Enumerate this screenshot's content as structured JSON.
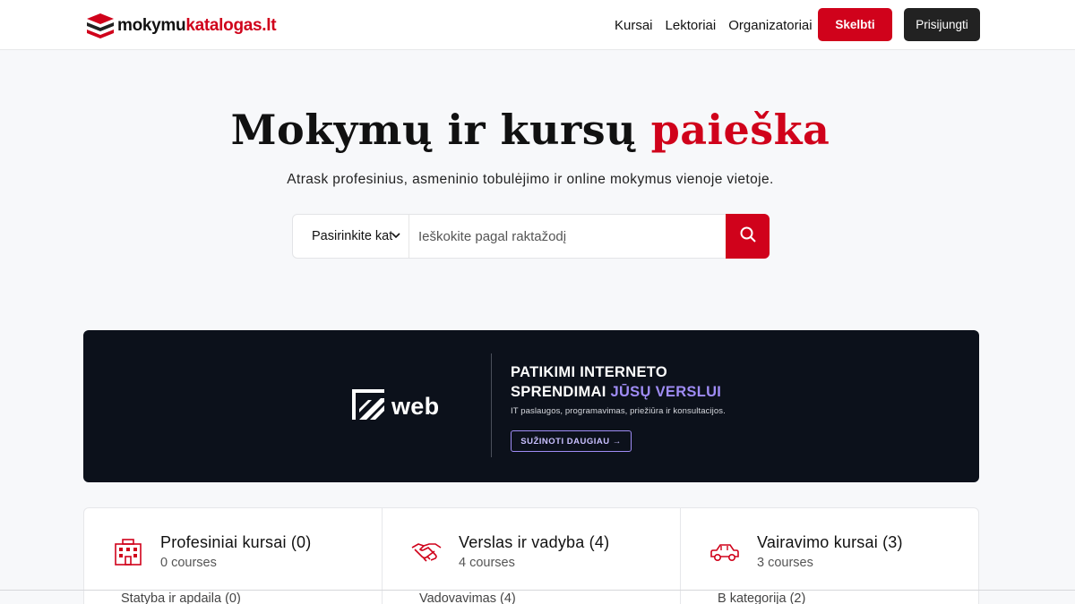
{
  "header": {
    "logo": {
      "part1": "mokymu",
      "part2": "katalogas.lt"
    },
    "nav": [
      {
        "label": "Kursai"
      },
      {
        "label": "Lektoriai"
      },
      {
        "label": "Organizatoriai"
      }
    ],
    "publish_label": "Skelbti",
    "login_label": "Prisijungti"
  },
  "hero": {
    "title_part1": "Mokymų ir kursų",
    "title_part2": "paieška",
    "subtitle": "Atrask profesinius, asmeninio tobulėjimo ir online mokymus vienoje vietoje."
  },
  "search": {
    "category_selected": "Pasirinkite kat",
    "placeholder": "Ieškokite pagal raktažodį"
  },
  "banner": {
    "brand": "web",
    "headline_line1": "PATIKIMI INTERNETO",
    "headline_line2_plain": "SPRENDIMAI",
    "headline_line2_accent": "JŪSŲ VERSLUI",
    "text": "IT paslaugos, programavimas, priežiūra ir konsultacijos.",
    "cta": "SUŽINOTI DAUGIAU →"
  },
  "categories": [
    {
      "title": "Profesiniai kursai (0)",
      "count": "0 courses",
      "sub": "Statyba ir apdaila (0)",
      "icon": "building-icon"
    },
    {
      "title": "Verslas ir vadyba (4)",
      "count": "4 courses",
      "sub": "Vadovavimas (4)",
      "icon": "handshake-icon"
    },
    {
      "title": "Vairavimo kursai (3)",
      "count": "3 courses",
      "sub": "B kategorija (2)",
      "icon": "car-icon"
    }
  ],
  "colors": {
    "brand_red": "#d0021b",
    "dark": "#222222",
    "banner_bg": "#0c111b",
    "banner_accent": "#9f8cf5"
  }
}
